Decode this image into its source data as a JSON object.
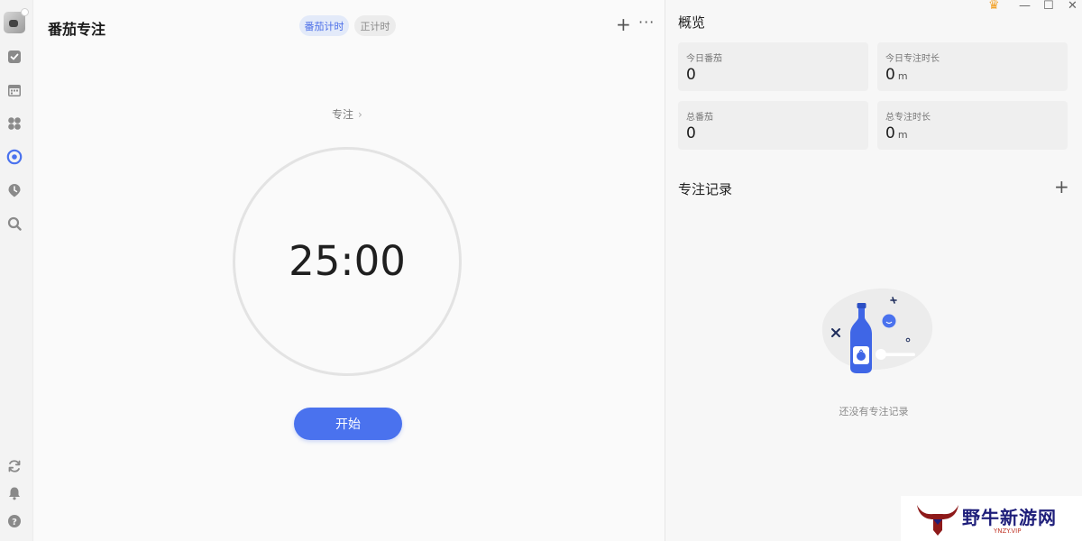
{
  "sidebar": {
    "items": [
      {
        "icon": "checkbox-icon"
      },
      {
        "icon": "calendar-icon"
      },
      {
        "icon": "grid-icon"
      },
      {
        "icon": "focus-target-icon",
        "active": true
      },
      {
        "icon": "location-clock-icon"
      },
      {
        "icon": "search-icon"
      }
    ],
    "bottom_items": [
      {
        "icon": "sync-icon"
      },
      {
        "icon": "bell-icon"
      },
      {
        "icon": "help-icon"
      }
    ]
  },
  "main": {
    "title": "番茄专注",
    "mode_tabs": [
      {
        "label": "番茄计时",
        "active": true
      },
      {
        "label": "正计时",
        "active": false
      }
    ],
    "add_label": "+",
    "more_label": "···",
    "focus_mode_label": "专注",
    "focus_mode_chevron": "›",
    "timer": "25:00",
    "start_button": "开始"
  },
  "right": {
    "overview_title": "概览",
    "stats": [
      {
        "label": "今日番茄",
        "value": "0",
        "unit": ""
      },
      {
        "label": "今日专注时长",
        "value": "0",
        "unit": "m"
      },
      {
        "label": "总番茄",
        "value": "0",
        "unit": ""
      },
      {
        "label": "总专注时长",
        "value": "0",
        "unit": "m"
      }
    ],
    "records_title": "专注记录",
    "records_add": "+",
    "empty_text": "还没有专注记录"
  },
  "window": {
    "crown": "♛",
    "minimize": "—",
    "maximize": "☐",
    "close": "✕"
  },
  "watermark": {
    "text": "野牛新游网",
    "sub": "YNZY.VIP"
  },
  "colors": {
    "accent": "#4a72ee",
    "accent_light": "#e3eaf9",
    "crown": "#f2a22a"
  }
}
